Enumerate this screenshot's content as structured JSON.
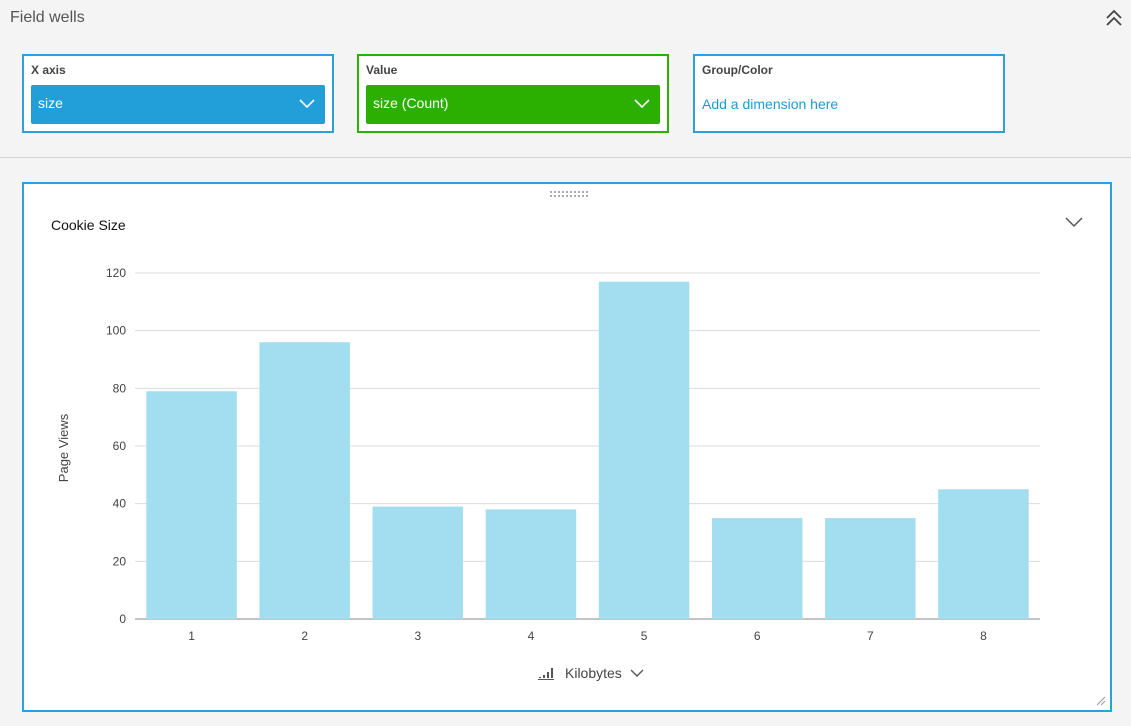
{
  "field_wells": {
    "title": "Field wells",
    "collapse_icon": "double-chevron-up-icon",
    "x_axis": {
      "label": "X axis",
      "value": "size",
      "color": "#229fd9"
    },
    "value": {
      "label": "Value",
      "value": "size (Count)",
      "color": "#2baf00"
    },
    "group_color": {
      "label": "Group/Color",
      "placeholder": "Add a dimension here",
      "link_color": "#1e9ad6"
    }
  },
  "visual": {
    "title": "Cookie Size",
    "border_color": "#2ea0d6",
    "menu_icon": "chevron-down-icon",
    "x_axis_control": {
      "label": "Kilobytes",
      "icon": "sort-icon"
    }
  },
  "chart_data": {
    "type": "bar",
    "title": "Cookie Size",
    "categories": [
      "1",
      "2",
      "3",
      "4",
      "5",
      "6",
      "7",
      "8"
    ],
    "values": [
      79,
      96,
      39,
      38,
      117,
      35,
      35,
      45
    ],
    "ylabel": "Page Views",
    "xlabel": "Kilobytes",
    "ylim": [
      0,
      120
    ],
    "yticks": [
      0,
      20,
      40,
      60,
      80,
      100,
      120
    ],
    "bar_color": "#a3def0",
    "grid": true
  }
}
